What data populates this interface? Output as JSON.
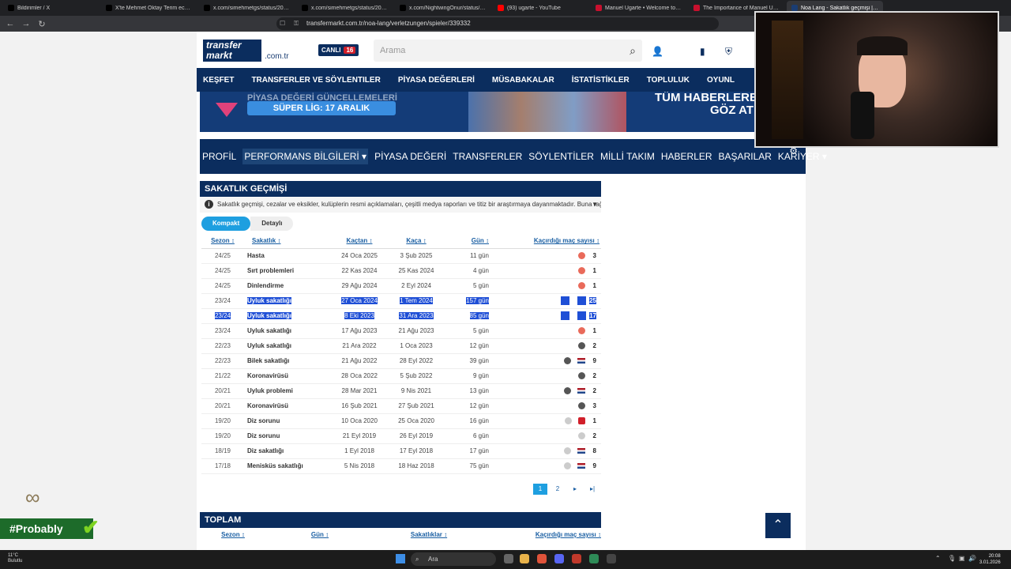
{
  "browser": {
    "tabs": [
      {
        "label": "Bildirimler / X",
        "color": "#000000"
      },
      {
        "label": "X'te Mehmet Oktay Terim ece \"@biyo",
        "color": "#000000"
      },
      {
        "label": "x.com/simehmetgs/status/2007492",
        "color": "#000000"
      },
      {
        "label": "x.com/simehmetgs/status/2007492",
        "color": "#000000"
      },
      {
        "label": "x.com/NightwingOnur/status/2007",
        "color": "#000000"
      },
      {
        "label": "(93) ugarte - YouTube",
        "color": "#ff0000"
      },
      {
        "label": "Manuel Ugarte • Welcome to Galat",
        "color": "#c8102e"
      },
      {
        "label": "The Importance of Manuel Ugarte",
        "color": "#c8102e"
      },
      {
        "label": "Noa Lang - Sakatlık geçmişi | Tr",
        "color": "#1a3d73"
      }
    ],
    "url": "transfermarkt.com.tr/noa-lang/verletzungen/spieler/339332"
  },
  "site": {
    "logo": "transfer markt",
    "domain": ".com.tr",
    "live_label": "CANLI",
    "live_count": "16",
    "search_placeholder": "Arama",
    "main_nav": [
      "KEŞFET",
      "TRANSFERLER VE SÖYLENTILER",
      "PİYASA DEĞERLERİ",
      "MÜSABAKALAR",
      "İSTATİSTİKLER",
      "TOPLULUK",
      "OYUNL"
    ],
    "banner": {
      "line1": "PİYASA DEĞERİ GÜNCELLEMELERİ",
      "line2": "SÜPER LİG: 17 ARALIK",
      "line3": "TÜM HABERLERE GÖZ AT!"
    },
    "profile_nav": [
      "PROFİL",
      "PERFORMANS BİLGİLERİ ▾",
      "PİYASA DEĞERİ",
      "TRANSFERLER",
      "SÖYLENTİLER",
      "MİLLİ TAKIM",
      "HABERLER",
      "BAŞARILAR",
      "KARİYER ▾"
    ]
  },
  "injuries": {
    "title": "SAKATLIK GEÇMİŞİ",
    "info": "Sakatlık geçmişi, cezalar ve eksikler, kulüplerin resmi açıklamaları, çeşitli medya raporları ve titiz bir araştırmaya dayanmaktadır. Buna rağme...",
    "tabs": [
      "Kompakt",
      "Detaylı"
    ],
    "headers": [
      "Sezon ↕",
      "Sakatlık ↕",
      "Kaçtan ↕",
      "Kaça ↕",
      "Gün ↕",
      "Kaçırdığı maç sayısı ↕"
    ],
    "rows": [
      {
        "season": "24/25",
        "injury": "Hasta",
        "from": "24 Oca 2025",
        "until": "3 Şub 2025",
        "days": "11 gün",
        "games": "3",
        "club": "#e96a5a",
        "flag": false,
        "selected": false
      },
      {
        "season": "24/25",
        "injury": "Sırt problemleri",
        "from": "22 Kas 2024",
        "until": "25 Kas 2024",
        "days": "4 gün",
        "games": "1",
        "club": "#e96a5a",
        "flag": false,
        "selected": false
      },
      {
        "season": "24/25",
        "injury": "Dinlendirme",
        "from": "29 Ağu 2024",
        "until": "2 Eyl 2024",
        "days": "5 gün",
        "games": "1",
        "club": "#e96a5a",
        "flag": false,
        "selected": false
      },
      {
        "season": "23/24",
        "injury": "Uyluk sakatlığı",
        "from": "27 Oca 2024",
        "until": "1 Tem 2024",
        "days": "157 gün",
        "games": "25",
        "club": "#1f4fd6",
        "flag": false,
        "selected": true,
        "season_sel": false
      },
      {
        "season": "23/24",
        "injury": "Uyluk sakatlığı",
        "from": "8 Eki 2023",
        "until": "31 Ara 2023",
        "days": "85 gün",
        "games": "17",
        "club": "#1f4fd6",
        "flag": false,
        "selected": true,
        "season_sel": true
      },
      {
        "season": "23/24",
        "injury": "Uyluk sakatlığı",
        "from": "17 Ağu 2023",
        "until": "21 Ağu 2023",
        "days": "5 gün",
        "games": "1",
        "club": "#e96a5a",
        "flag": false,
        "selected": false
      },
      {
        "season": "22/23",
        "injury": "Uyluk sakatlığı",
        "from": "21 Ara 2022",
        "until": "1 Oca 2023",
        "days": "12 gün",
        "games": "2",
        "club": "#555555",
        "flag": false,
        "selected": false
      },
      {
        "season": "22/23",
        "injury": "Bilek sakatlığı",
        "from": "21 Ağu 2022",
        "until": "28 Eyl 2022",
        "days": "39 gün",
        "games": "9",
        "club": "#555555",
        "flag": true,
        "selected": false
      },
      {
        "season": "21/22",
        "injury": "Koronavirüsü",
        "from": "28 Oca 2022",
        "until": "5 Şub 2022",
        "days": "9 gün",
        "games": "2",
        "club": "#555555",
        "flag": false,
        "selected": false
      },
      {
        "season": "20/21",
        "injury": "Uyluk problemi",
        "from": "28 Mar 2021",
        "until": "9 Nis 2021",
        "days": "13 gün",
        "games": "2",
        "club": "#555555",
        "flag": true,
        "selected": false
      },
      {
        "season": "20/21",
        "injury": "Koronavirüsü",
        "from": "16 Şub 2021",
        "until": "27 Şub 2021",
        "days": "12 gün",
        "games": "3",
        "club": "#555555",
        "flag": false,
        "selected": false
      },
      {
        "season": "19/20",
        "injury": "Diz sorunu",
        "from": "10 Oca 2020",
        "until": "25 Oca 2020",
        "days": "16 gün",
        "games": "1",
        "club": "#cccccc",
        "flag": false,
        "selected": false,
        "extra": "#d11f2a"
      },
      {
        "season": "19/20",
        "injury": "Diz sorunu",
        "from": "21 Eyl 2019",
        "until": "26 Eyl 2019",
        "days": "6 gün",
        "games": "2",
        "club": "#cccccc",
        "flag": false,
        "selected": false
      },
      {
        "season": "18/19",
        "injury": "Diz sakatlığı",
        "from": "1 Eyl 2018",
        "until": "17 Eyl 2018",
        "days": "17 gün",
        "games": "8",
        "club": "#cccccc",
        "flag": true,
        "selected": false
      },
      {
        "season": "17/18",
        "injury": "Menisküs sakatlığı",
        "from": "5 Nis 2018",
        "until": "18 Haz 2018",
        "days": "75 gün",
        "games": "9",
        "club": "#cccccc",
        "flag": true,
        "selected": false
      }
    ],
    "pager": [
      "1",
      "2",
      "▸",
      "▸|"
    ]
  },
  "summary": {
    "title": "TOPLAM",
    "headers": [
      "Sezon ↕",
      "Gün ↕",
      "Sakatlıklar ↕",
      "Kaçırdığı maç sayısı ↕"
    ]
  },
  "overlay": {
    "probably": "#Probably"
  },
  "taskbar": {
    "weather_temp": "11°C",
    "weather_desc": "Bulutlu",
    "search": "Ara",
    "time": "20:08",
    "date": "3.01.2026"
  }
}
